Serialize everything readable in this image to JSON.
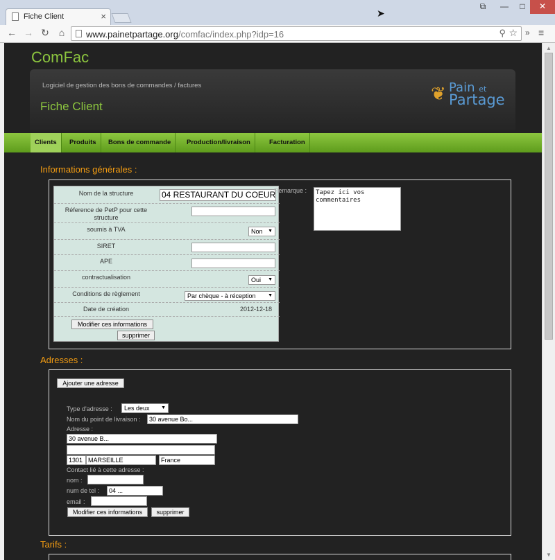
{
  "browser": {
    "tab_title": "Fiche Client",
    "url_host": "www.painetpartage.org",
    "url_path": "/comfac/index.php?idp=16",
    "tab_close": "×",
    "win_restore": "⧉",
    "win_min": "—",
    "win_max": "□",
    "win_close": "✕"
  },
  "site": {
    "title": "ComFac",
    "tagline": "Logiciel de gestion des bons de commandes / factures",
    "page_title": "Fiche Client",
    "logo_line1": "Pain",
    "logo_line1_small": "et",
    "logo_line2": "Partage"
  },
  "nav": {
    "items": [
      {
        "label": "Clients"
      },
      {
        "label": "Produits"
      },
      {
        "label": "Bons de commande"
      },
      {
        "label": "Production/livraison"
      },
      {
        "label": "Facturation"
      }
    ]
  },
  "info": {
    "heading": "Informations générales :",
    "nom_label": "Nom de la structure",
    "nom_value": "04 RESTAURANT DU COEUR",
    "ref_label": "Réference de PetP pour cette structure",
    "ref_value": "",
    "tva_label": "soumis à TVA",
    "tva_value": "Non",
    "siret_label": "SIRET",
    "siret_value": "",
    "ape_label": "APE",
    "ape_value": "",
    "contract_label": "contractualisation",
    "contract_value": "Oui",
    "conditions_label": "Conditions de règlement",
    "conditions_value": "Par chèque - à réception",
    "date_label": "Date de création",
    "date_value": "2012-12-18",
    "modify_button": "Modifier ces informations",
    "delete_button": "supprimer",
    "remark_label": "Remarque :",
    "remark_value": "Tapez ici vos commentaires"
  },
  "addresses": {
    "heading": "Adresses :",
    "add_button": "Ajouter une adresse",
    "type_label": "Type d'adresse :",
    "type_value": "Les deux",
    "point_label": "Nom du point de livraison :",
    "point_value": "30 avenue Bo...",
    "adresse_label": "Adresse :",
    "line1_value": "30 avenue B...",
    "line2_value": "",
    "postcode_value": "1301",
    "city_value": "MARSEILLE",
    "country_value": "France",
    "contact_label": "Contact lié à cette adresse :",
    "nom_label": "nom :",
    "nom_value": "",
    "tel_label": "num de tel :",
    "tel_value": "04 ...",
    "email_label": "email :",
    "email_value": "",
    "modify_button": "Modifier ces informations",
    "delete_button": "supprimer"
  },
  "tarifs": {
    "heading": "Tarifs :"
  }
}
